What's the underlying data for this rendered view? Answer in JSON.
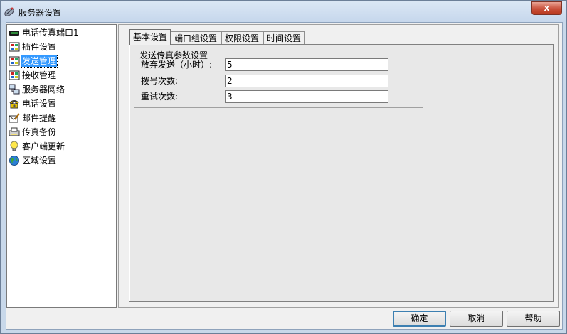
{
  "window": {
    "title": "服务器设置",
    "close_label": "x"
  },
  "tree": {
    "items": [
      {
        "label": "电话传真端口1",
        "icon": "modem-icon",
        "selected": false
      },
      {
        "label": "插件设置",
        "icon": "plugin-icon",
        "selected": false
      },
      {
        "label": "发送管理",
        "icon": "send-icon",
        "selected": true
      },
      {
        "label": "接收管理",
        "icon": "receive-icon",
        "selected": false
      },
      {
        "label": "服务器网络",
        "icon": "network-icon",
        "selected": false
      },
      {
        "label": "电话设置",
        "icon": "phone-icon",
        "selected": false
      },
      {
        "label": "邮件提醒",
        "icon": "mail-icon",
        "selected": false
      },
      {
        "label": "传真备份",
        "icon": "backup-icon",
        "selected": false
      },
      {
        "label": "客户端更新",
        "icon": "bulb-icon",
        "selected": false
      },
      {
        "label": "区域设置",
        "icon": "globe-icon",
        "selected": false
      }
    ]
  },
  "tabs": [
    {
      "label": "基本设置",
      "active": true
    },
    {
      "label": "端口组设置",
      "active": false
    },
    {
      "label": "权限设置",
      "active": false
    },
    {
      "label": "时间设置",
      "active": false
    }
  ],
  "group": {
    "title": "发送传真参数设置",
    "fields": [
      {
        "label": "放弃发送（小时）:",
        "value": "5"
      },
      {
        "label": "拨号次数:",
        "value": "2"
      },
      {
        "label": "重试次数:",
        "value": "3"
      }
    ]
  },
  "buttons": {
    "ok": "确定",
    "cancel": "取消",
    "help": "帮助"
  }
}
